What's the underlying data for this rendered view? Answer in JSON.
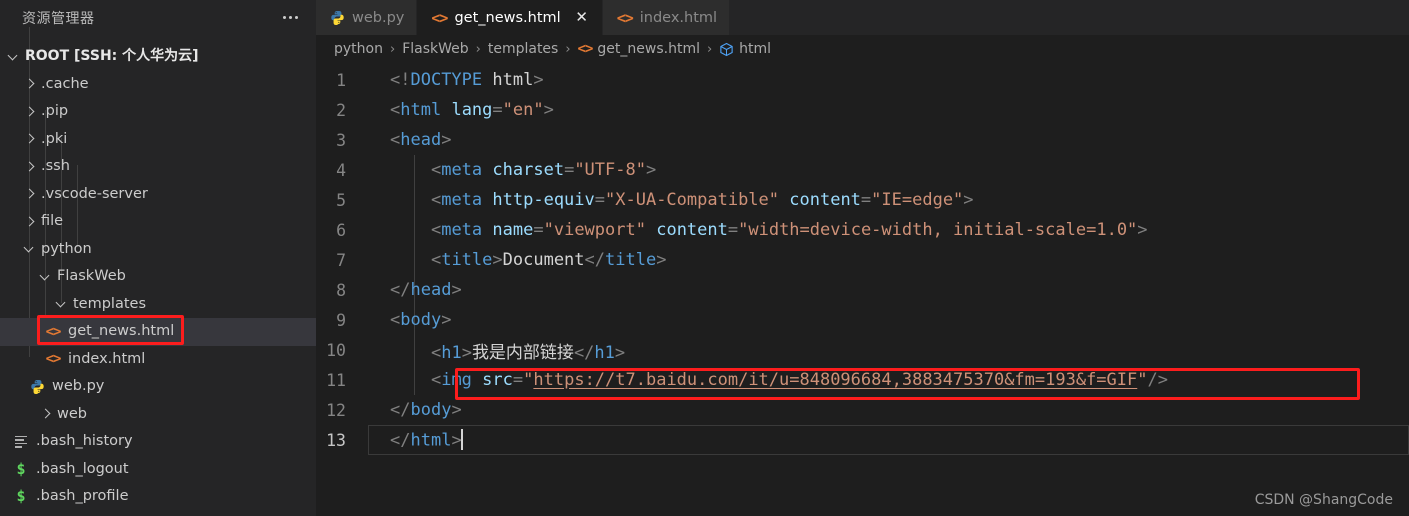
{
  "sidebar": {
    "title": "资源管理器",
    "more_icon": "ellipsis-icon",
    "root": {
      "label": "ROOT [SSH: 个人华为云]",
      "expanded": true
    },
    "items": [
      {
        "label": ".cache",
        "icon": "chevron-right-icon",
        "depth": 1,
        "type": "folder",
        "expanded": false
      },
      {
        "label": ".pip",
        "icon": "chevron-right-icon",
        "depth": 1,
        "type": "folder",
        "expanded": false
      },
      {
        "label": ".pki",
        "icon": "chevron-right-icon",
        "depth": 1,
        "type": "folder",
        "expanded": false
      },
      {
        "label": ".ssh",
        "icon": "chevron-right-icon",
        "depth": 1,
        "type": "folder",
        "expanded": false
      },
      {
        "label": ".vscode-server",
        "icon": "chevron-right-icon",
        "depth": 1,
        "type": "folder",
        "expanded": false
      },
      {
        "label": "file",
        "icon": "chevron-right-icon",
        "depth": 1,
        "type": "folder",
        "expanded": false
      },
      {
        "label": "python",
        "icon": "chevron-down-icon",
        "depth": 1,
        "type": "folder",
        "expanded": true
      },
      {
        "label": "FlaskWeb",
        "icon": "chevron-down-icon",
        "depth": 2,
        "type": "folder",
        "expanded": true
      },
      {
        "label": "templates",
        "icon": "chevron-down-icon",
        "depth": 3,
        "type": "folder",
        "expanded": true
      },
      {
        "label": "get_news.html",
        "icon": "html-file-icon",
        "depth": 4,
        "type": "html",
        "selected": true,
        "annotated": true
      },
      {
        "label": "index.html",
        "icon": "html-file-icon",
        "depth": 4,
        "type": "html"
      },
      {
        "label": "web.py",
        "icon": "python-file-icon",
        "depth": 3,
        "type": "python"
      },
      {
        "label": "web",
        "icon": "chevron-right-icon",
        "depth": 2,
        "type": "folder",
        "expanded": false
      },
      {
        "label": ".bash_history",
        "icon": "lines-file-icon",
        "depth": 1,
        "type": "lines"
      },
      {
        "label": ".bash_logout",
        "icon": "shell-file-icon",
        "depth": 1,
        "type": "shell"
      },
      {
        "label": ".bash_profile",
        "icon": "shell-file-icon",
        "depth": 1,
        "type": "shell"
      }
    ]
  },
  "tabs": [
    {
      "label": "web.py",
      "icon": "python-file-icon",
      "active": false,
      "closable": false
    },
    {
      "label": "get_news.html",
      "icon": "html-file-icon",
      "active": true,
      "closable": true,
      "close_label": "✕"
    },
    {
      "label": "index.html",
      "icon": "html-file-icon",
      "active": false,
      "closable": false
    }
  ],
  "breadcrumb": {
    "separator": "›",
    "items": [
      {
        "label": "python",
        "icon": ""
      },
      {
        "label": "FlaskWeb",
        "icon": ""
      },
      {
        "label": "templates",
        "icon": ""
      },
      {
        "label": "get_news.html",
        "icon": "html-file-icon"
      },
      {
        "label": "html",
        "icon": "symbol-html-icon"
      }
    ]
  },
  "editor": {
    "lines": [
      {
        "n": "1",
        "text": "<!DOCTYPE html>"
      },
      {
        "n": "2",
        "text": "<html lang=\"en\">"
      },
      {
        "n": "3",
        "text": "<head>"
      },
      {
        "n": "4",
        "text": "    <meta charset=\"UTF-8\">"
      },
      {
        "n": "5",
        "text": "    <meta http-equiv=\"X-UA-Compatible\" content=\"IE=edge\">"
      },
      {
        "n": "6",
        "text": "    <meta name=\"viewport\" content=\"width=device-width, initial-scale=1.0\">"
      },
      {
        "n": "7",
        "text": "    <title>Document</title>"
      },
      {
        "n": "8",
        "text": "</head>"
      },
      {
        "n": "9",
        "text": "<body>"
      },
      {
        "n": "10",
        "text": "    <h1>我是内部链接</h1>"
      },
      {
        "n": "11",
        "text": "    <img src=\"https://t7.baidu.com/it/u=848096684,3883475370&fm=193&f=GIF\"/>",
        "annotated": true
      },
      {
        "n": "12",
        "text": "</body>"
      },
      {
        "n": "13",
        "text": "</html>",
        "current": true,
        "cursor": true
      }
    ],
    "image_url": "https://t7.baidu.com/it/u=848096684,3883475370&fm=193&f=GIF",
    "heading_text": "我是内部链接"
  },
  "watermark": "CSDN @ShangCode",
  "colors": {
    "annotation_red": "#fc1d1d",
    "tag_blue": "#569cd6",
    "attribute_blue": "#9cdcfe",
    "string_orange": "#ce9178",
    "bracket_gray": "#808080",
    "text_white": "#d4d4d4",
    "html_icon_orange": "#e37933",
    "shell_icon_green": "#5fd75f",
    "editor_bg": "#1e1e1e",
    "sidebar_bg": "#252526",
    "selection_bg": "#37373d"
  }
}
